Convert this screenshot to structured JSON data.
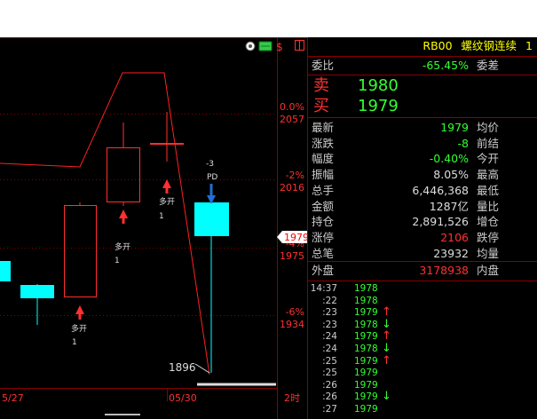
{
  "header": {
    "code": "RB00",
    "name": "螺纹钢连续",
    "index": "1"
  },
  "weibi": {
    "label": "委比",
    "value": "-65.45%",
    "diff_label": "委差"
  },
  "sell": {
    "label": "卖",
    "price": "1980"
  },
  "buy": {
    "label": "买",
    "price": "1979"
  },
  "quote_rows": [
    {
      "label": "最新",
      "value": "1979",
      "color": "green",
      "label2": "均价"
    },
    {
      "label": "涨跌",
      "value": "-8",
      "color": "green",
      "label2": "前结"
    },
    {
      "label": "幅度",
      "value": "-0.40%",
      "color": "green",
      "label2": "今开"
    },
    {
      "label": "振幅",
      "value": "8.05%",
      "color": "white",
      "label2": "最高"
    },
    {
      "label": "总手",
      "value": "6,446,368",
      "color": "white",
      "label2": "最低"
    },
    {
      "label": "金额",
      "value": "1287亿",
      "color": "white",
      "label2": "量比"
    },
    {
      "label": "持仓",
      "value": "2,891,526",
      "color": "white",
      "label2": "增仓"
    },
    {
      "label": "涨停",
      "value": "2106",
      "color": "red",
      "label2": "跌停"
    },
    {
      "label": "总笔",
      "value": "23932",
      "color": "white",
      "label2": "均量"
    }
  ],
  "outer": {
    "label": "外盘",
    "value": "3178938",
    "label2": "内盘"
  },
  "ticks": [
    {
      "time": "14:37",
      "price": "1978",
      "arrow": ""
    },
    {
      "time": ":22",
      "price": "1978",
      "arrow": ""
    },
    {
      "time": ":23",
      "price": "1979",
      "arrow": "↑"
    },
    {
      "time": ":23",
      "price": "1978",
      "arrow": "↓"
    },
    {
      "time": ":24",
      "price": "1979",
      "arrow": "↑"
    },
    {
      "time": ":24",
      "price": "1978",
      "arrow": "↓"
    },
    {
      "time": ":25",
      "price": "1979",
      "arrow": "↑"
    },
    {
      "time": ":25",
      "price": "1979",
      "arrow": ""
    },
    {
      "time": ":26",
      "price": "1979",
      "arrow": ""
    },
    {
      "time": ":26",
      "price": "1979",
      "arrow": "↓"
    },
    {
      "time": ":27",
      "price": "1979",
      "arrow": ""
    }
  ],
  "chart": {
    "pct_labels": [
      "0.0%",
      "-2%",
      "-4%",
      "-6%"
    ],
    "price_labels": [
      "2057",
      "2016",
      "1975",
      "1934"
    ],
    "current_price": "1979",
    "low_label": "1896",
    "dates": [
      "5/27",
      "05/30"
    ],
    "period": "2时",
    "signals": [
      {
        "text": "多开",
        "count": "1"
      },
      {
        "text": "多开",
        "count": "1"
      },
      {
        "text": "多开",
        "count": "1"
      }
    ],
    "pd_signal": {
      "text": "PD",
      "count": "-3"
    },
    "toolbar_icons": [
      "settings-icon",
      "money-icon",
      "currency-icon",
      "panel-icon"
    ]
  },
  "colors": {
    "up": "#ff3030",
    "down": "#00ffff",
    "accent": "#ffff00",
    "grid": "#8a0000",
    "price": "#33ff33"
  }
}
